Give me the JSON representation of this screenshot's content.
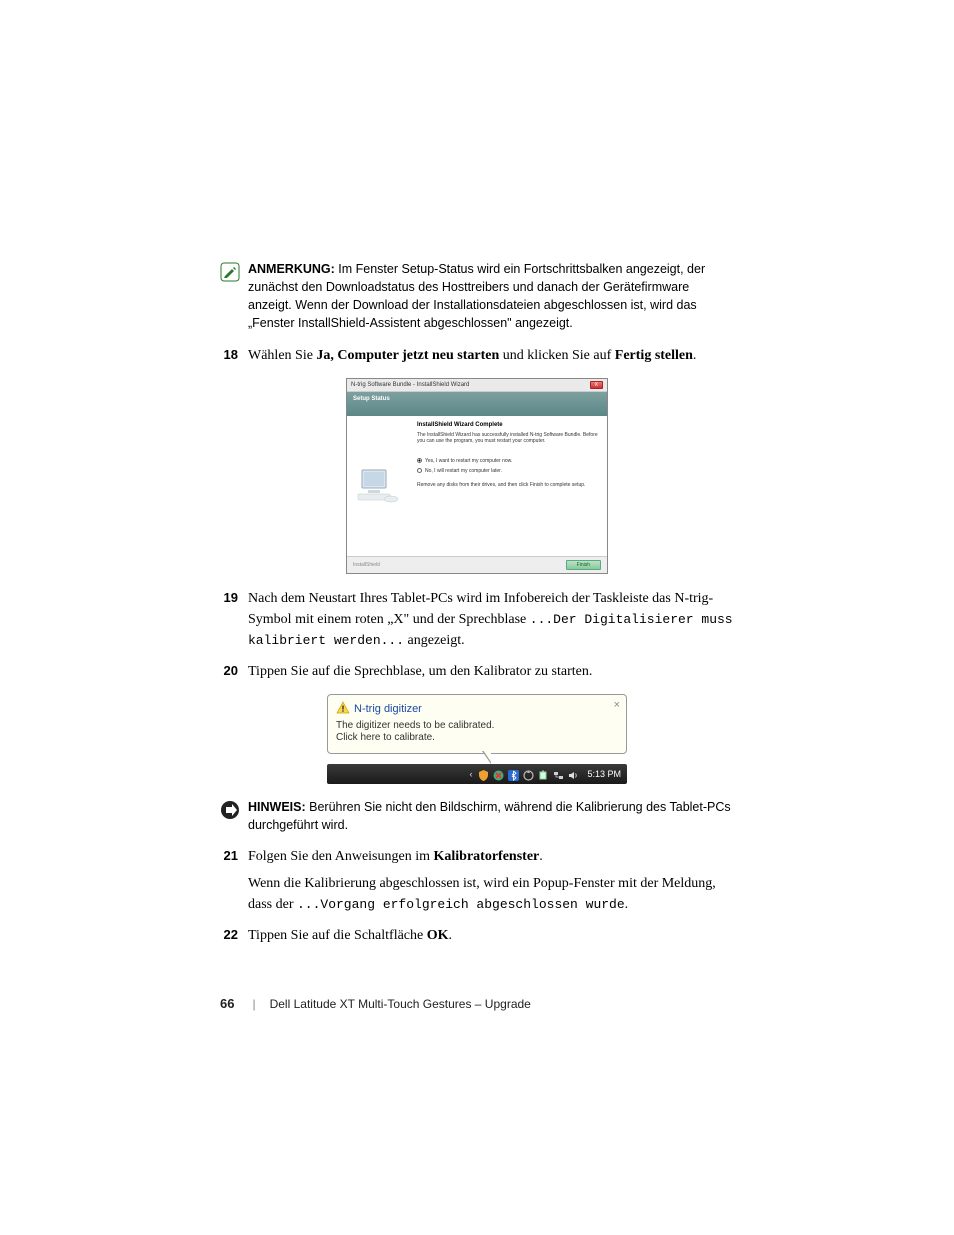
{
  "notes": {
    "anmerkung": {
      "label": "ANMERKUNG:",
      "text": " Im Fenster Setup-Status wird ein Fortschrittsbalken angezeigt, der zunächst den Downloadstatus des Hosttreibers und danach der Gerätefirmware anzeigt. Wenn der Download der Installationsdateien abgeschlossen ist, wird das „Fenster InstallShield-Assistent abgeschlossen\" angezeigt."
    },
    "hinweis": {
      "label": "HINWEIS:",
      "text": " Berühren Sie nicht den Bildschirm, während die Kalibrierung des Tablet-PCs durchgeführt wird."
    }
  },
  "steps": {
    "s18": {
      "num": "18",
      "pre": "Wählen Sie ",
      "bold1": "Ja, Computer jetzt neu starten",
      "mid": " und klicken Sie auf ",
      "bold2": "Fertig stellen",
      "post": "."
    },
    "s19": {
      "num": "19",
      "pre": "Nach dem Neustart Ihres Tablet-PCs wird im Infobereich der Taskleiste das N-trig-Symbol mit einem roten „X\" und der Sprechblase ",
      "mono1": "...Der Digitalisierer muss kalibriert werden...",
      "post": " angezeigt."
    },
    "s20": {
      "num": "20",
      "text": "Tippen Sie auf die Sprechblase, um den Kalibrator zu starten."
    },
    "s21": {
      "num": "21",
      "pre": "Folgen Sie den Anweisungen im ",
      "bold1": "Kalibratorfenster",
      "post": ".",
      "para2_pre": "Wenn die Kalibrierung abgeschlossen ist, wird ein Popup-Fenster mit der Meldung, dass der ",
      "para2_mono": "...Vorgang erfolgreich abgeschlossen wurde",
      "para2_post": "."
    },
    "s22": {
      "num": "22",
      "pre": "Tippen Sie auf die Schaltfläche ",
      "bold1": "OK",
      "post": "."
    }
  },
  "wizard": {
    "title": "N-trig Software Bundle - InstallShield Wizard",
    "close": "X",
    "header": "Setup Status",
    "heading": "InstallShield Wizard Complete",
    "desc": "The InstallShield Wizard has successfully installed N-trig Software Bundle. Before you can use the program, you must restart your computer.",
    "opt1": "Yes, I want to restart my computer now.",
    "opt2": "No, I will restart my computer later.",
    "remove": "Remove any disks from their drives, and then click Finish to complete setup.",
    "installshield": "InstallShield",
    "finish": "Finish"
  },
  "balloon": {
    "title": "N-trig digitizer",
    "line1": "The digitizer needs to be calibrated.",
    "line2": "Click here to calibrate.",
    "close": "×"
  },
  "taskbar": {
    "time": "5:13 PM"
  },
  "footer": {
    "page": "66",
    "title": "Dell Latitude XT Multi-Touch Gestures – Upgrade"
  }
}
